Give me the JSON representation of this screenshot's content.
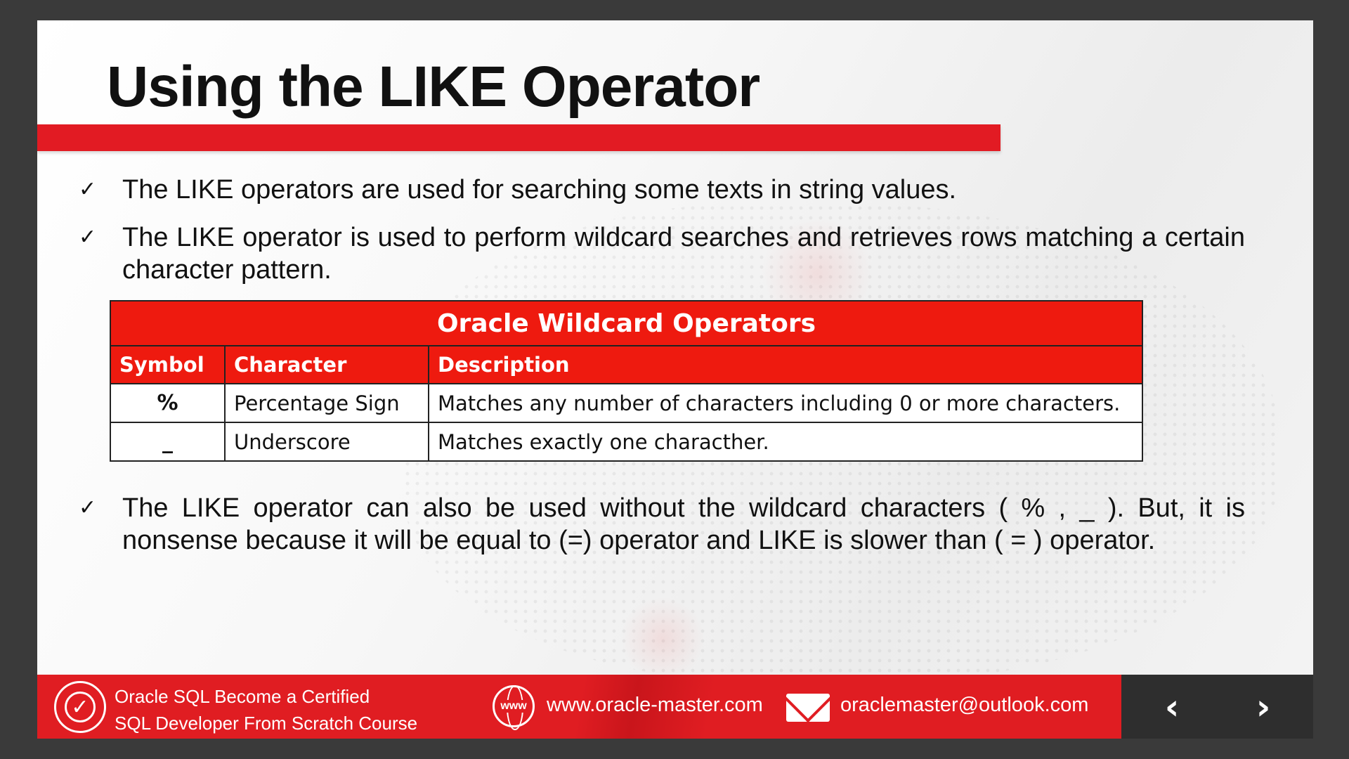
{
  "slide": {
    "title": "Using the LIKE Operator",
    "bullets": [
      "The LIKE operators are used for searching some texts in string values.",
      "The LIKE operator is used to perform wildcard searches and retrieves rows matching a certain character pattern.",
      "The LIKE operator can also be used without the wildcard characters ( % , _ ). But, it is nonsense  because it will be equal to (=) operator and LIKE is slower than ( = ) operator."
    ],
    "check_glyph": "✓"
  },
  "table": {
    "caption": "Oracle Wildcard Operators",
    "headers": [
      "Symbol",
      "Character",
      "Description"
    ],
    "rows": [
      [
        "%",
        "Percentage Sign",
        "Matches any number of characters including 0 or more characters."
      ],
      [
        "_",
        "Underscore",
        "Matches exactly one characther."
      ]
    ]
  },
  "footer": {
    "badge_icon": "certified-check-icon",
    "course_line1": "Oracle SQL Become a Certified",
    "course_line2": "SQL  Developer  From Scratch Course",
    "globe_label": "www",
    "website": "www.oracle-master.com",
    "email": "oraclemaster@outlook.com",
    "prev_glyph": "‹",
    "next_glyph": "›"
  },
  "colors": {
    "accent_red": "#e21b23",
    "table_red": "#ee1a0f",
    "frame_dark": "#3a3a3a"
  }
}
